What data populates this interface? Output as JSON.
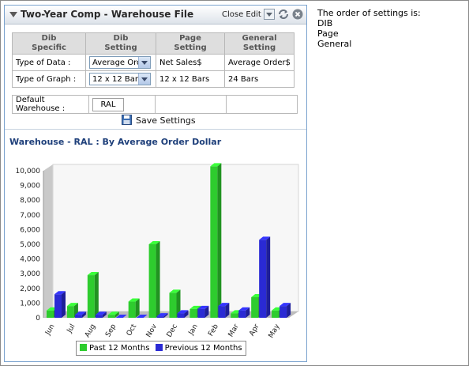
{
  "panel": {
    "title": "Two-Year Comp - Warehouse File",
    "close_edit": "Close Edit"
  },
  "settings_table": {
    "headers": [
      "Dib\nSpecific",
      "Dib\nSetting",
      "Page\nSetting",
      "General\nSetting"
    ],
    "rows": [
      {
        "label": "Type of Data :",
        "dib": "Average Orde",
        "page": "Net Sales$",
        "general": "Average Order$"
      },
      {
        "label": "Type of Graph :",
        "dib": "12 x 12 Bars",
        "page": "12 x 12 Bars",
        "general": "24 Bars"
      }
    ],
    "default_warehouse_label": "Default Warehouse :",
    "default_warehouse_value": "RAL"
  },
  "save_button": "Save Settings",
  "chart_data": {
    "type": "bar",
    "title": "Warehouse - RAL : By Average Order Dollar",
    "categories": [
      "Jun",
      "Jul",
      "Aug",
      "Sep",
      "Oct",
      "Nov",
      "Dec",
      "Jan",
      "Feb",
      "Mar",
      "Apr",
      "May"
    ],
    "series": [
      {
        "name": "Past 12 Months",
        "color": "#2ecc2e",
        "values": [
          500,
          800,
          2900,
          200,
          1100,
          5000,
          1700,
          600,
          10300,
          300,
          1400,
          500
        ]
      },
      {
        "name": "Previous 12 Months",
        "color": "#2a2ad4",
        "values": [
          1600,
          200,
          200,
          0,
          0,
          100,
          300,
          600,
          800,
          500,
          5300,
          800
        ]
      }
    ],
    "ylim": [
      0,
      10000
    ],
    "yticks": [
      "0",
      "1,000",
      "2,000",
      "3,000",
      "4,000",
      "5,000",
      "6,000",
      "7,000",
      "8,000",
      "9,000",
      "10,000"
    ],
    "legend": "bottom"
  },
  "note": {
    "lines": [
      "The order of settings is:",
      "DIB",
      "Page",
      "General"
    ]
  }
}
